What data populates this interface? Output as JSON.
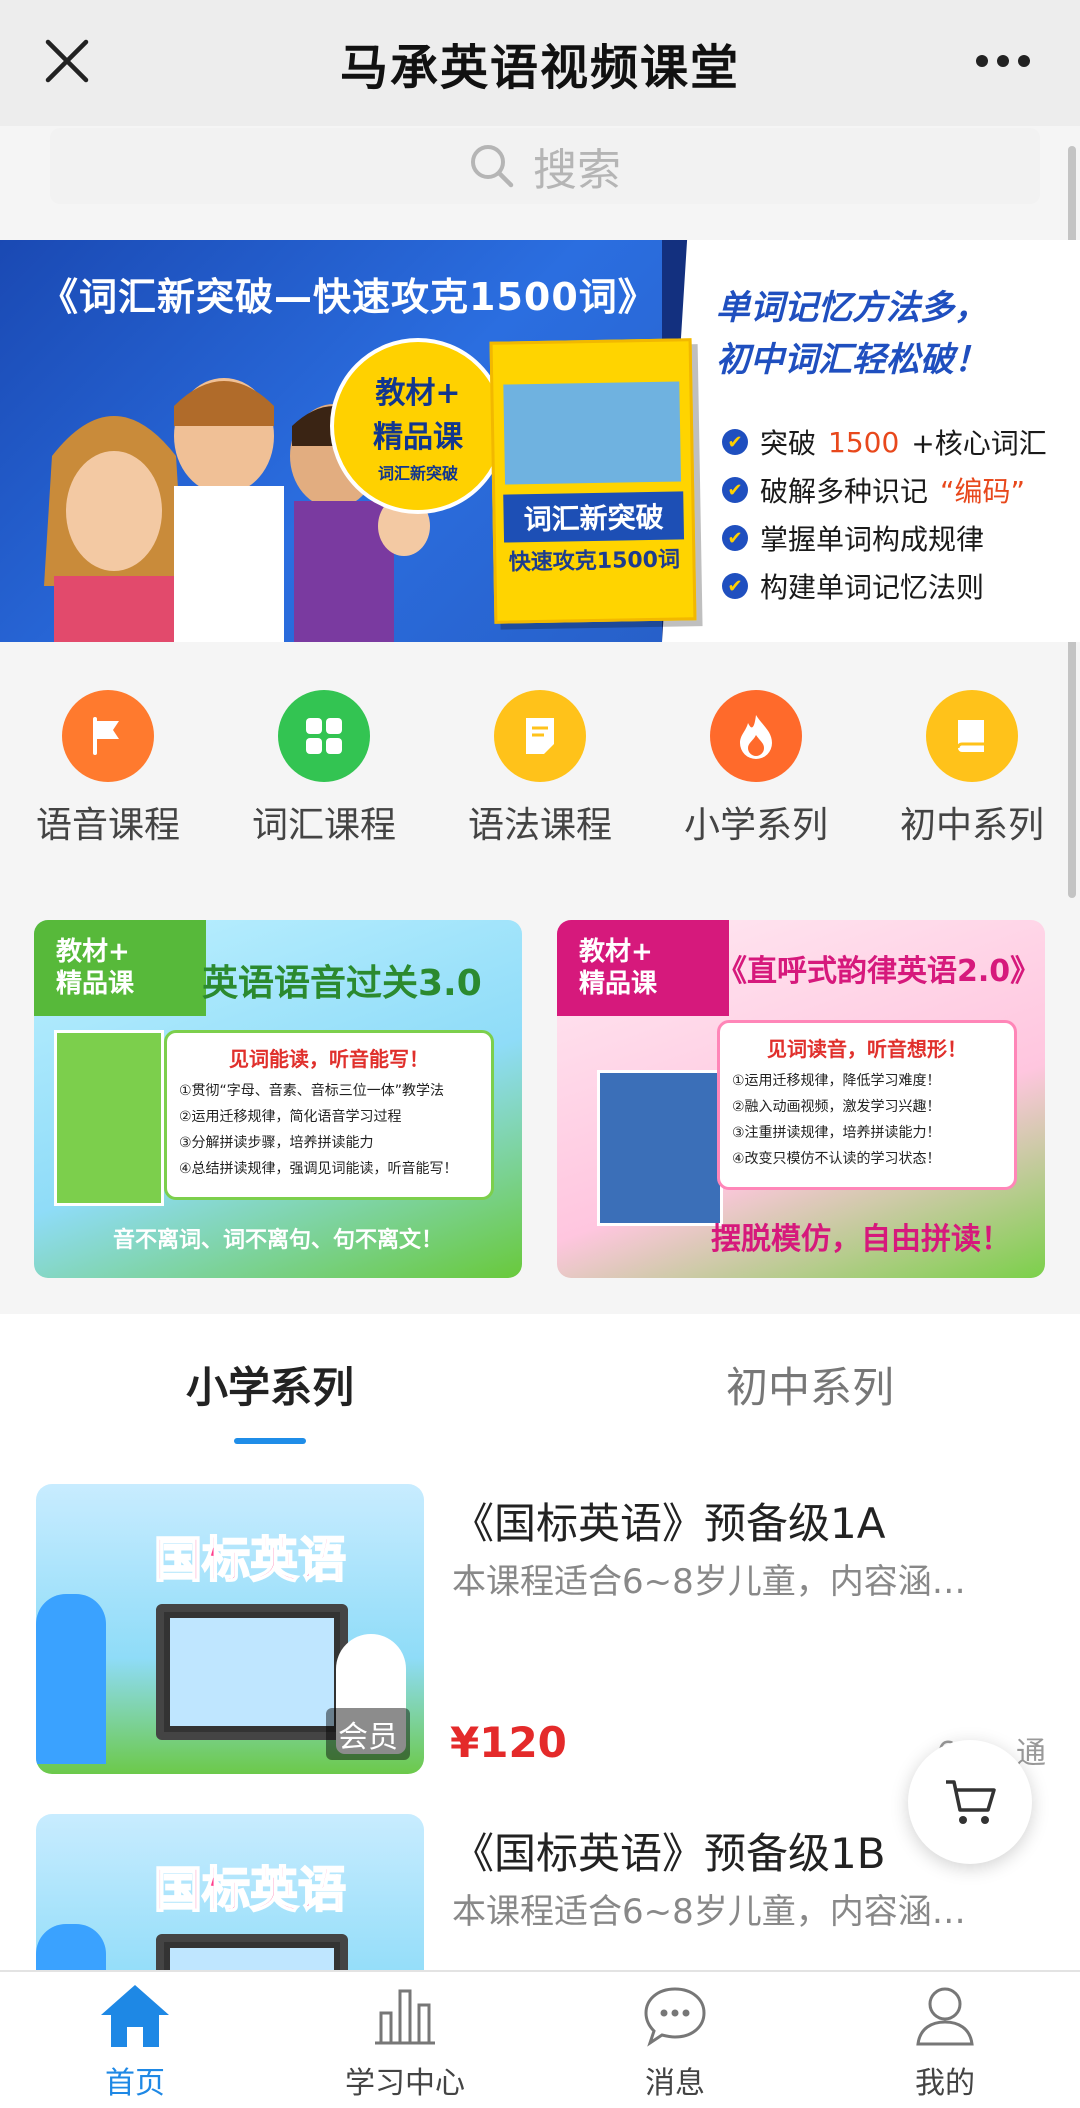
{
  "header": {
    "title": "马承英语视频课堂"
  },
  "search": {
    "placeholder": "搜索"
  },
  "banner": {
    "title": "《词汇新突破—快速攻克1500词》",
    "badge": [
      "教材+",
      "精品课",
      "词汇新突破"
    ],
    "book_title": "词汇新突破",
    "book_subtitle": "快速攻克1500词",
    "slogan_line1": "单词记忆方法多，",
    "slogan_line2": "初中词汇轻松破！",
    "points": [
      {
        "pre": "突破",
        "hl": "1500",
        "post": "+核心词汇"
      },
      {
        "pre": "破解多种识记",
        "hl": "“编码”",
        "post": ""
      },
      {
        "pre": "掌握单词构成规律",
        "hl": "",
        "post": ""
      },
      {
        "pre": "构建单词记忆法则",
        "hl": "",
        "post": ""
      }
    ],
    "slides": 4,
    "active_slide": 0
  },
  "categories": [
    {
      "label": "语音课程",
      "icon": "flag-icon",
      "color": "#ff7a2e"
    },
    {
      "label": "词汇课程",
      "icon": "grid-icon",
      "color": "#33c452"
    },
    {
      "label": "语法课程",
      "icon": "document-icon",
      "color": "#ffc21a"
    },
    {
      "label": "小学系列",
      "icon": "flame-icon",
      "color": "#ff6a2b"
    },
    {
      "label": "初中系列",
      "icon": "book-icon",
      "color": "#ffc21a"
    }
  ],
  "promos": [
    {
      "tag1": "教材+",
      "tag2": "精品课",
      "title": "英语语音过关3.0",
      "headline": "见词能读，听音能写！",
      "lines": [
        "①贯彻“字母、音素、音标三位一体”教学法",
        "②运用迁移规律，简化语音学习过程",
        "③分解拼读步骤，培养拼读能力",
        "④总结拼读规律，强调见词能读，听音能写！"
      ],
      "footer": "音不离词、词不离句、句不离文！"
    },
    {
      "tag1": "教材+",
      "tag2": "精品课",
      "title": "《直呼式韵律英语2.0》",
      "headline": "见词读音，听音想形！",
      "lines": [
        "①运用迁移规律，降低学习难度！",
        "②融入动画视频，激发学习兴趣！",
        "③注重拼读规律，培养拼读能力！",
        "④改变只模仿不认读的学习状态！"
      ],
      "footer": "摆脱模仿，自由拼读！"
    }
  ],
  "tabs": [
    {
      "label": "小学系列",
      "active": true
    },
    {
      "label": "初中系列",
      "active": false
    }
  ],
  "courses": [
    {
      "title": "《国标英语》预备级1A",
      "desc": "本课程适合6~8岁儿童，内容涵…",
      "thumb_text": "国标英语",
      "badge": "会员",
      "price": "¥120",
      "count": "6……通"
    },
    {
      "title": "《国标英语》预备级1B",
      "desc": "本课程适合6~8岁儿童，内容涵…",
      "thumb_text": "国标英语",
      "badge": "",
      "price": "",
      "count": ""
    }
  ],
  "bottom_nav": [
    {
      "label": "首页",
      "icon": "home-icon",
      "active": true
    },
    {
      "label": "学习中心",
      "icon": "chart-icon",
      "active": false
    },
    {
      "label": "消息",
      "icon": "chat-icon",
      "active": false
    },
    {
      "label": "我的",
      "icon": "user-icon",
      "active": false
    }
  ],
  "colors": {
    "accent": "#1e88e5",
    "price": "#e42a2a"
  }
}
